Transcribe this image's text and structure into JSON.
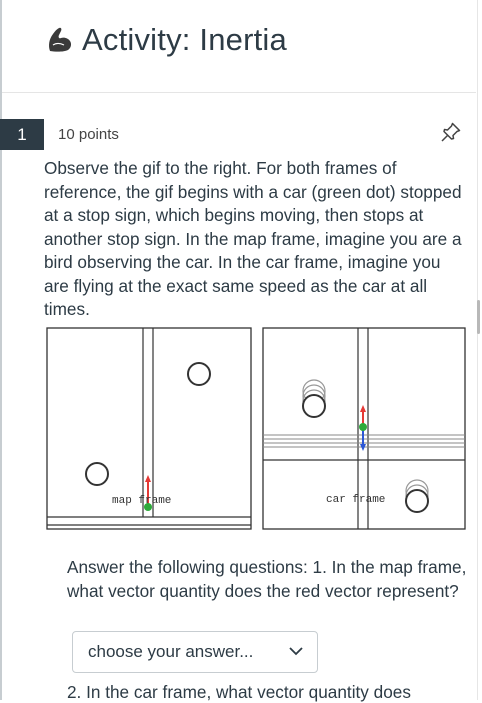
{
  "header": {
    "title": "Activity: Inertia",
    "icon": "flexed-arm-icon"
  },
  "question": {
    "number": "1",
    "points": "10 points",
    "prompt": "Observe the gif to the right. For both frames of reference, the gif begins with a car (green dot) stopped at a stop sign, which begins moving, then stops at another stop sign. In the map frame, imagine you are a bird observing the car. In the car frame, imagine you are flying at the exact same speed as the car at all times.",
    "gif": {
      "map_label": "map frame",
      "car_label": "car frame",
      "colors": {
        "vector": "#e53935",
        "car_dot": "#2eaa3a",
        "blue_vector": "#2c57d6"
      }
    },
    "instructions": "Answer the following questions: 1. In the map frame, what vector quantity does the red vector represent?",
    "dropdown": {
      "selected": "choose your answer..."
    },
    "next_prompt": "2. In the car frame, what vector quantity does"
  }
}
